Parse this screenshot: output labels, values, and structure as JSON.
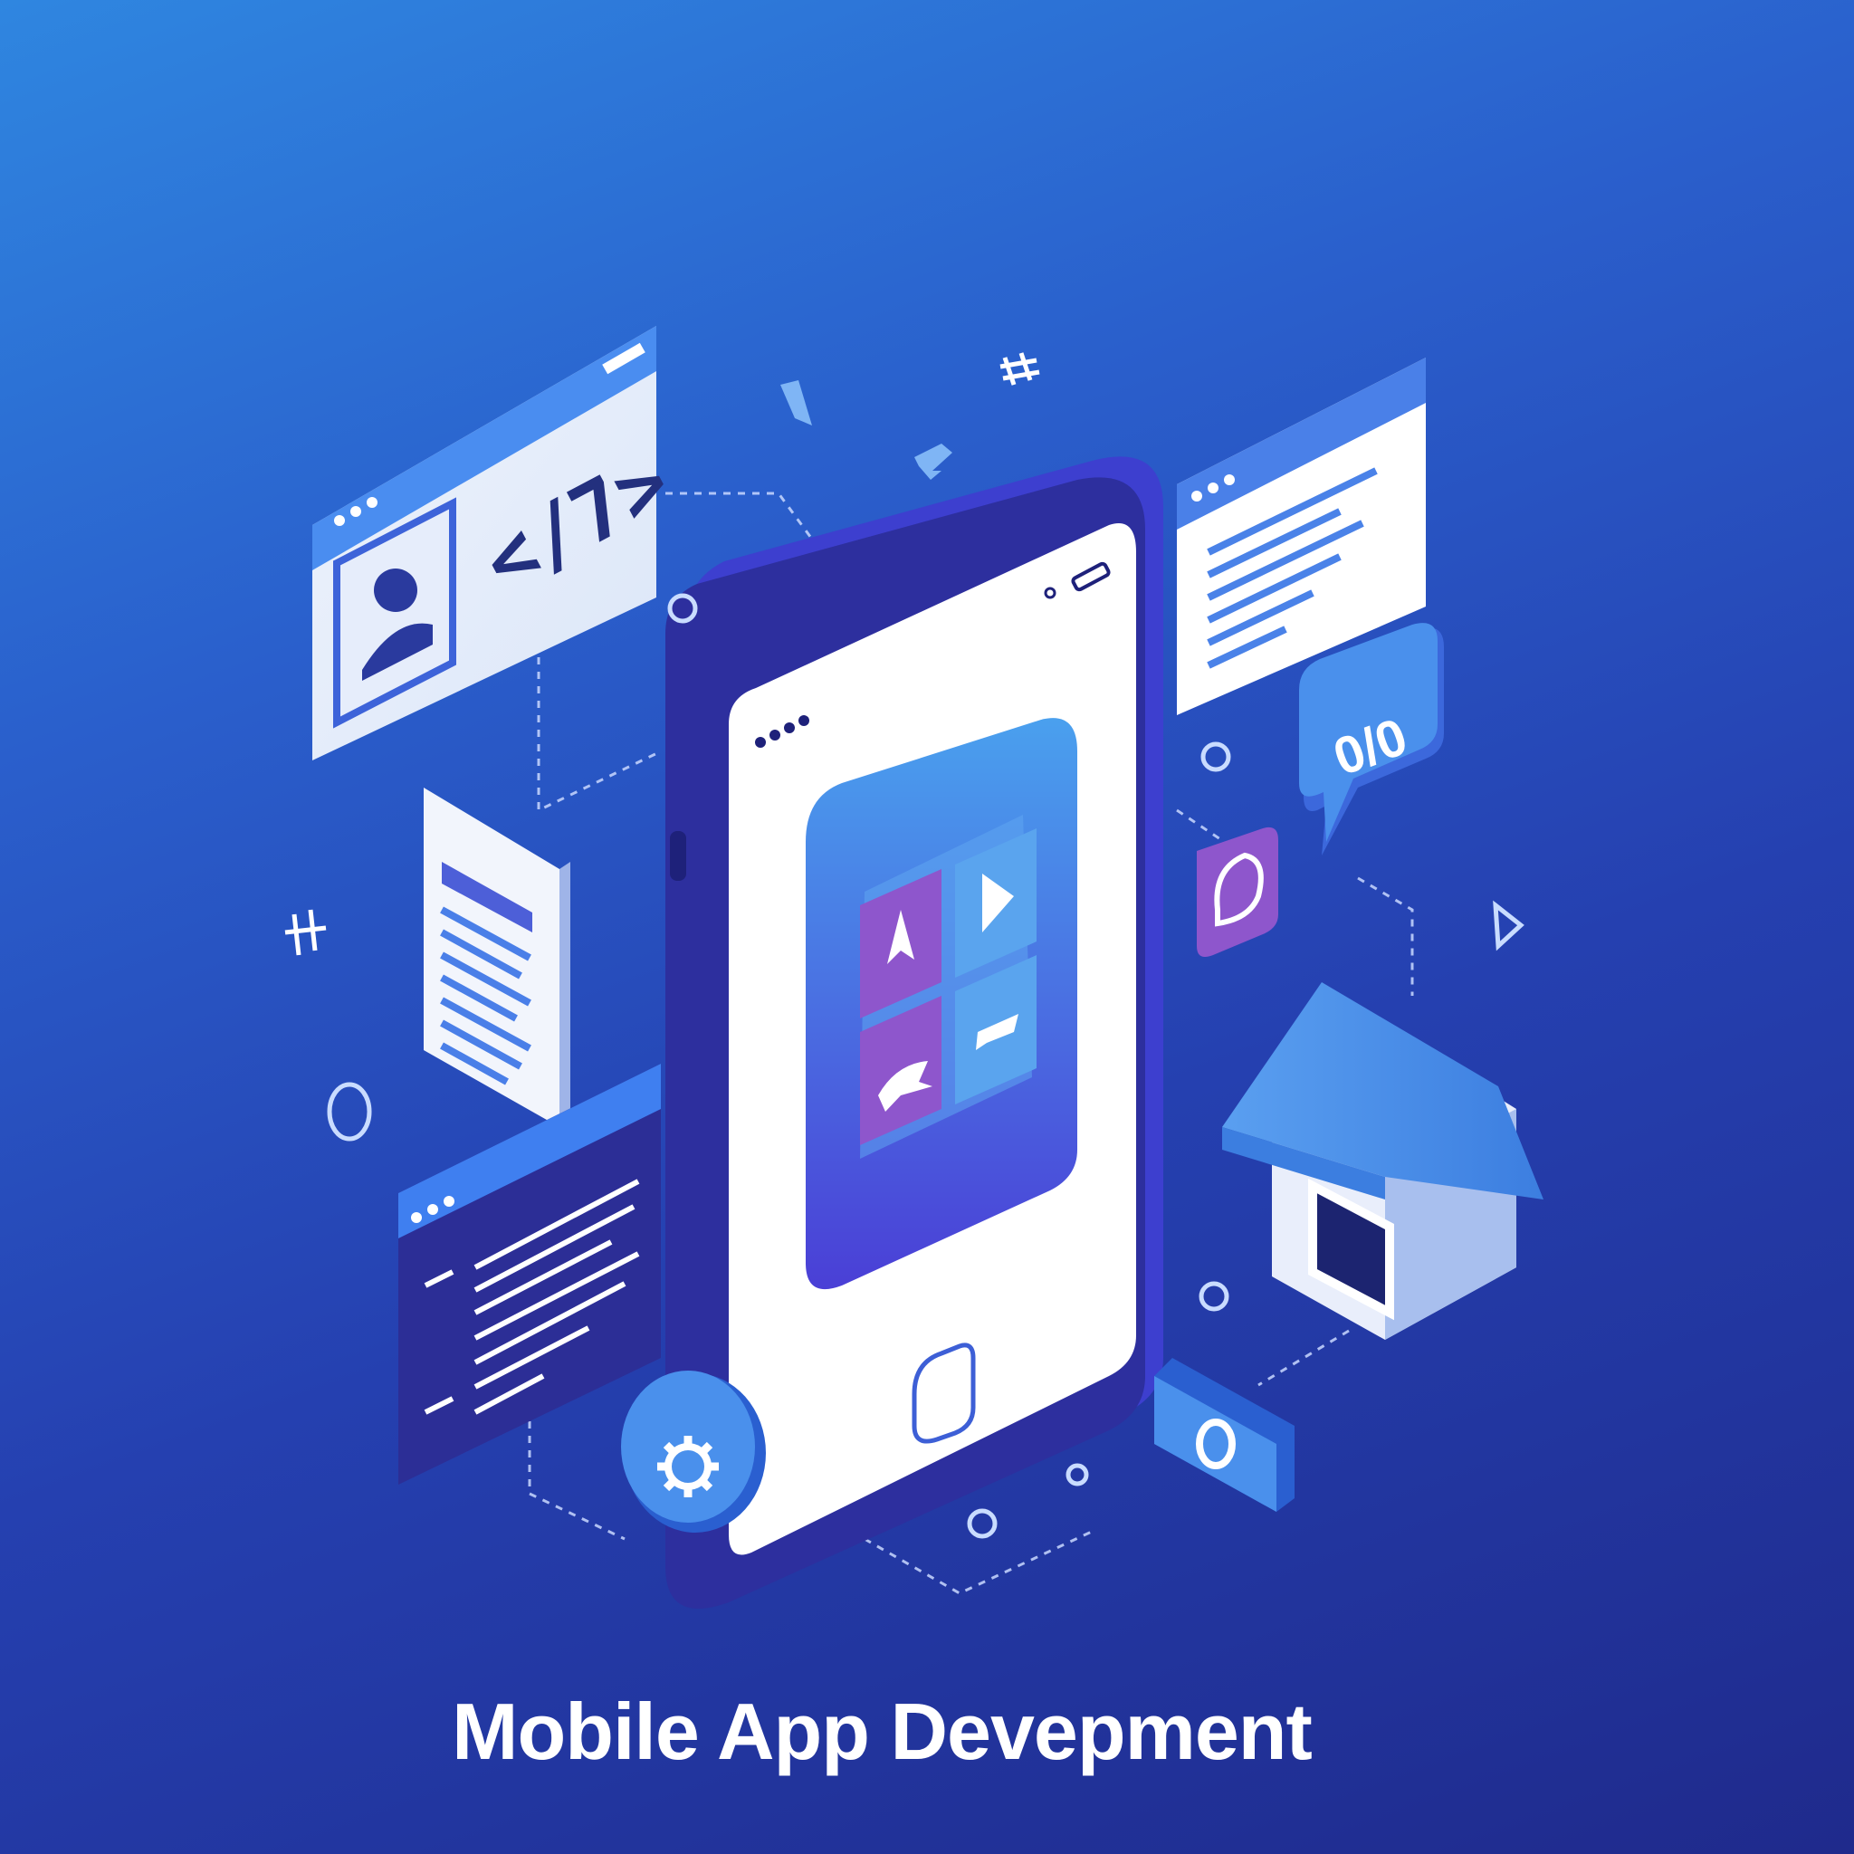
{
  "title": "Mobile App Devepment",
  "code_glyph": "</7>",
  "bubble_text": "0/0",
  "colors": {
    "bg_top": "#2f86e0",
    "bg_bottom": "#1f2a8c",
    "phone_frame": "#3d3fcf",
    "screen": "#ffffff",
    "accent_blue": "#4a90ec",
    "accent_purple": "#8e56cc"
  },
  "icons": [
    "user-icon",
    "code-icon",
    "gear-icon",
    "store-icon",
    "shield-icon",
    "play-icon",
    "chat-icon",
    "hash-icon"
  ]
}
